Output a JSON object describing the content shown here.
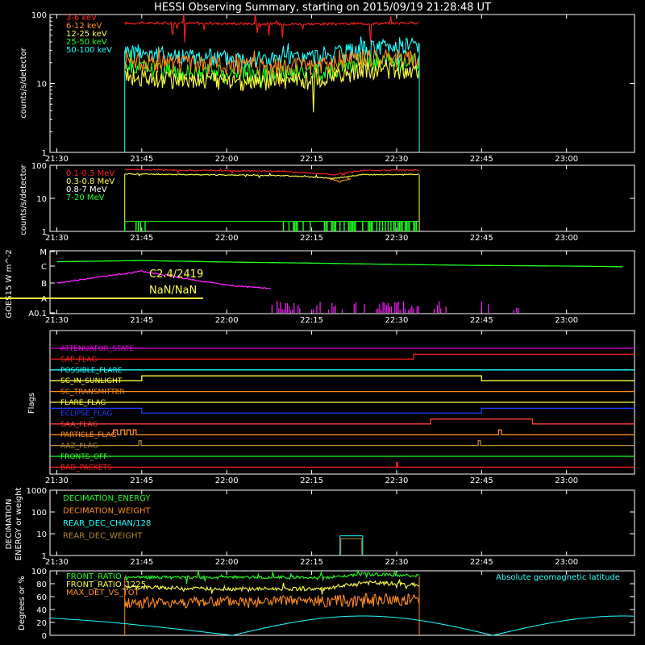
{
  "title": "HESSI Observing Summary, starting on 2015/09/19 21:28:48 UT",
  "time_ticks": [
    "21:30",
    "21:45",
    "22:00",
    "22:15",
    "22:30",
    "22:45",
    "23:00"
  ],
  "chart_data": [
    {
      "id": "rate1",
      "type": "line",
      "ylabel": "counts/s/detector",
      "yscale": "log",
      "ylim": [
        1,
        100
      ],
      "yticks": [
        "1",
        "10",
        "100"
      ],
      "legend": [
        {
          "name": "3-6 keV",
          "color": "#ff2020"
        },
        {
          "name": "6-12 keV",
          "color": "#ff8c1a"
        },
        {
          "name": "12-25 keV",
          "color": "#ffff40"
        },
        {
          "name": "25-50 keV",
          "color": "#20ff20"
        },
        {
          "name": "50-100 keV",
          "color": "#20ffff"
        }
      ],
      "x": [
        "21:42",
        "21:50",
        "22:00",
        "22:10",
        "22:18",
        "22:24",
        "22:30",
        "22:34"
      ],
      "series": [
        {
          "name": "3-6 keV",
          "values": [
            75,
            75,
            74,
            73,
            73,
            74,
            75,
            76
          ]
        },
        {
          "name": "6-12 keV",
          "values": [
            22,
            20,
            19,
            18,
            19,
            24,
            24,
            24
          ]
        },
        {
          "name": "12-25 keV",
          "values": [
            13,
            12,
            11,
            11,
            12,
            16,
            16,
            16
          ]
        },
        {
          "name": "25-50 keV",
          "values": [
            18,
            16,
            15,
            14,
            16,
            21,
            22,
            22
          ]
        },
        {
          "name": "50-100 keV",
          "values": [
            30,
            26,
            24,
            23,
            25,
            32,
            36,
            38
          ]
        }
      ]
    },
    {
      "id": "rate2",
      "type": "line",
      "ylabel": "counts/s/detector",
      "yscale": "log",
      "ylim": [
        1,
        100
      ],
      "yticks": [
        "1",
        "10",
        "100"
      ],
      "legend": [
        {
          "name": "0.1-0.3 MeV",
          "color": "#ff2020"
        },
        {
          "name": "0.3-0.8 MeV",
          "color": "#ffff40"
        },
        {
          "name": "0.8-7 MeV",
          "color": "#ffffff"
        },
        {
          "name": "7-20 MeV",
          "color": "#20ff20"
        }
      ],
      "x": [
        "21:42",
        "21:55",
        "22:10",
        "22:19",
        "22:24",
        "22:34"
      ],
      "series": [
        {
          "name": "0.1-0.3 MeV",
          "values": [
            75,
            70,
            66,
            52,
            70,
            72
          ]
        },
        {
          "name": "0.3-0.8 MeV",
          "values": [
            55,
            52,
            49,
            40,
            52,
            53
          ]
        }
      ]
    },
    {
      "id": "goes",
      "type": "line",
      "ylabel": "GOES15 W m^-2",
      "yscale": "log",
      "yticks": [
        "A0.1",
        "A",
        "B",
        "C",
        "M"
      ],
      "annotations": [
        {
          "text": "C2.4/2419",
          "color": "#ffff40"
        },
        {
          "text": "NaN/NaN",
          "color": "#ffff40"
        }
      ],
      "x": [
        "21:30",
        "21:45",
        "22:00",
        "22:15",
        "22:30",
        "22:45",
        "23:00",
        "23:10"
      ],
      "series": [
        {
          "name": "long",
          "values": [
            "C2",
            "C2.4",
            "C1.9",
            "C1.6",
            "C1.3",
            "C1.1",
            "C1.0",
            "C0.9"
          ]
        },
        {
          "name": "short",
          "values": [
            "B1",
            "B5",
            "A7",
            "A3",
            "A1",
            "A0.1",
            "A0.1",
            "A0.1"
          ]
        }
      ]
    },
    {
      "id": "flags",
      "type": "timeline",
      "ylabel": "Flags",
      "flags": [
        {
          "name": "ATTENUATOR_STATE",
          "color": "#e000e0"
        },
        {
          "name": "SAP_FLAG",
          "color": "#ff2020"
        },
        {
          "name": "POSSIBLE_FLARE",
          "color": "#20ffff"
        },
        {
          "name": "SC_IN_SUNLIGHT",
          "color": "#ffff40"
        },
        {
          "name": "SC_TRANSMITTER",
          "color": "#ff8c1a"
        },
        {
          "name": "FLARE_FLAG",
          "color": "#ffff40"
        },
        {
          "name": "ECLIPSE_FLAG",
          "color": "#2040ff"
        },
        {
          "name": "SAA_FLAG",
          "color": "#ff4040"
        },
        {
          "name": "PARTICLE_FLAG",
          "color": "#ff8c1a"
        },
        {
          "name": "AAZ_FLAG",
          "color": "#b08a30"
        },
        {
          "name": "FRONTS_OFF",
          "color": "#20ff20"
        },
        {
          "name": "BAD_PACKETS",
          "color": "#ff2020"
        }
      ]
    },
    {
      "id": "decimation",
      "type": "line",
      "ylabel": "DECIMATION ENERGY or weight",
      "yscale": "log",
      "ylim": [
        1,
        1000
      ],
      "yticks": [
        "1",
        "10",
        "100",
        "1000"
      ],
      "legend": [
        {
          "name": "DECIMATION_ENERGY",
          "color": "#20ff20"
        },
        {
          "name": "DECIMATION_WEIGHT",
          "color": "#ff8c1a"
        },
        {
          "name": "REAR_DEC_CHAN/128",
          "color": "#20ffff"
        },
        {
          "name": "REAR_DEC_WEIGHT",
          "color": "#b08a30"
        }
      ],
      "x": [
        "22:20",
        "22:24"
      ],
      "series": [
        {
          "name": "REAR_DEC_CHAN/128",
          "values": [
            8,
            8
          ]
        },
        {
          "name": "REAR_DEC_WEIGHT",
          "values": [
            6,
            6
          ]
        }
      ]
    },
    {
      "id": "ratio",
      "type": "line",
      "ylabel": "Degrees or %",
      "ylim": [
        0,
        100
      ],
      "yticks": [
        "0",
        "20",
        "40",
        "60",
        "80",
        "100"
      ],
      "legend": [
        {
          "name": "FRONT_RATIO",
          "color": "#20ff20"
        },
        {
          "name": "FRONT_RATIO_1225",
          "color": "#ffff40"
        },
        {
          "name": "MAX_DET_VS_TOT",
          "color": "#ff8c1a"
        }
      ],
      "right_label": {
        "text": "Absolute geomagnetic latitude",
        "color": "#20ffff"
      },
      "x": [
        "21:42",
        "22:00",
        "22:18",
        "22:24",
        "22:34"
      ],
      "series": [
        {
          "name": "FRONT_RATIO",
          "values": [
            90,
            90,
            90,
            95,
            92
          ]
        },
        {
          "name": "FRONT_RATIO_1225",
          "values": [
            75,
            72,
            72,
            82,
            78
          ]
        },
        {
          "name": "MAX_DET_VS_TOT",
          "values": [
            50,
            52,
            53,
            55,
            55
          ]
        },
        {
          "name": "Absolute geomagnetic latitude",
          "values": [
            28,
            15,
            3,
            20,
            30
          ]
        }
      ]
    }
  ]
}
